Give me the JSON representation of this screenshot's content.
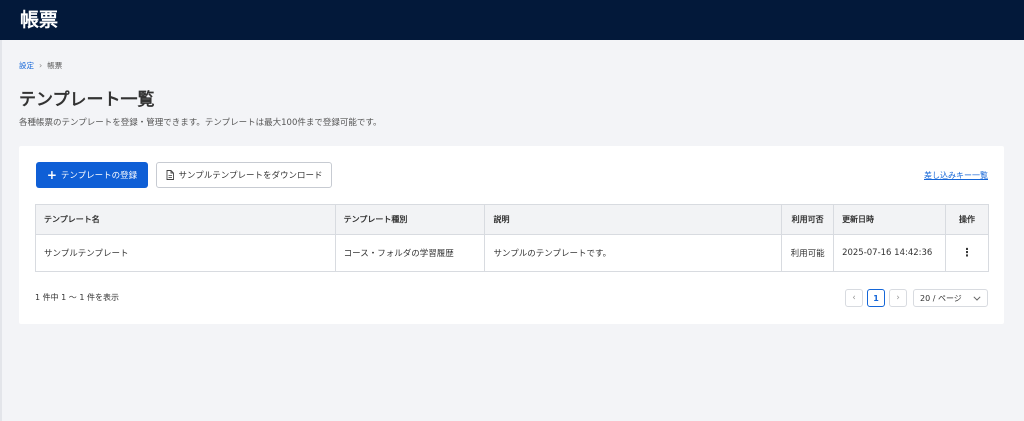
{
  "app": {
    "title": "帳票"
  },
  "breadcrumb": {
    "items": [
      "設定",
      "帳票"
    ],
    "separator": "›"
  },
  "page": {
    "title": "テンプレート一覧",
    "description": "各種帳票のテンプレートを登録・管理できます。テンプレートは最大100件まで登録可能です。"
  },
  "toolbar": {
    "register_label": "テンプレートの登録",
    "download_label": "サンプルテンプレートをダウンロード",
    "insert_keys_link": "差し込みキー一覧"
  },
  "table": {
    "columns": [
      "テンプレート名",
      "テンプレート種別",
      "説明",
      "利用可否",
      "更新日時",
      "操作"
    ],
    "rows": [
      {
        "name": "サンプルテンプレート",
        "type": "コース・フォルダの学習履歴",
        "description": "サンプルのテンプレートです。",
        "availability": "利用可能",
        "updated_at": "2025-07-16 14:42:36",
        "action": "⋮"
      }
    ]
  },
  "pagination": {
    "summary": "1 件中 1 〜 1 件を表示",
    "prev": "‹",
    "current_page": "1",
    "next": "›",
    "page_size": "20 / ページ"
  },
  "colors": {
    "header_bg": "#03193a",
    "primary": "#0f5fd6",
    "link": "#1466d8",
    "page_bg": "#f3f4f7"
  }
}
